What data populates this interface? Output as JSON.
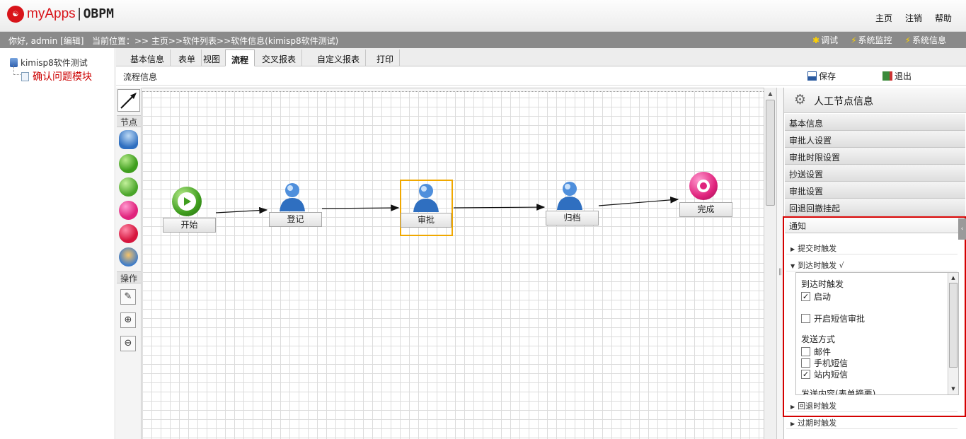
{
  "header": {
    "logo_mark": "OBPM",
    "logo_name": "myApps",
    "logo_product": "OBPM",
    "links": [
      "主页",
      "注销",
      "帮助"
    ]
  },
  "infobar": {
    "greeting": "你好, admin [编辑]",
    "breadcrumb": "当前位置：>> 主页>>软件列表>>软件信息(kimisp8软件测试)",
    "sys_links": [
      "调试",
      "系统监控",
      "系统信息"
    ]
  },
  "tree": {
    "root": "kimisp8软件测试",
    "child": "确认问题模块"
  },
  "tabs": [
    "基本信息",
    "表单",
    "视图",
    "流程",
    "交叉报表",
    "自定义报表",
    "打印"
  ],
  "active_tab": "流程",
  "subbar": {
    "title": "流程信息",
    "save": "保存",
    "exit": "退出"
  },
  "palette": {
    "nodes_label": "节点",
    "ops_label": "操作",
    "tools": [
      "✎",
      "⊕",
      "⊖"
    ]
  },
  "flow": {
    "nodes": [
      {
        "label": "开始",
        "type": "start"
      },
      {
        "label": "登记",
        "type": "manual"
      },
      {
        "label": "审批",
        "type": "manual",
        "selected": true
      },
      {
        "label": "归档",
        "type": "manual"
      },
      {
        "label": "完成",
        "type": "end"
      }
    ]
  },
  "panel": {
    "title": "人工节点信息",
    "sections": [
      "基本信息",
      "审批人设置",
      "审批时限设置",
      "抄送设置",
      "审批设置",
      "回退回撤挂起",
      "通知"
    ],
    "triggers": [
      {
        "label": "提交时触发",
        "arrow": "▶"
      },
      {
        "label": "到达时触发 √",
        "arrow": "▼"
      },
      {
        "label": "回退时触发",
        "arrow": "▶"
      },
      {
        "label": "过期时触发",
        "arrow": "▶"
      }
    ],
    "arrival": {
      "heading": "到达时触发",
      "enable": "启动",
      "sms_approve": "开启短信审批",
      "send_method": "发送方式",
      "email": "邮件",
      "mobile_sms": "手机短信",
      "internal_msg": "站内短信",
      "content_label": "发送内容(表单摘要)"
    },
    "checks": {
      "enable": true,
      "sms_approve": false,
      "email": false,
      "mobile_sms": false,
      "internal_msg": true
    }
  }
}
